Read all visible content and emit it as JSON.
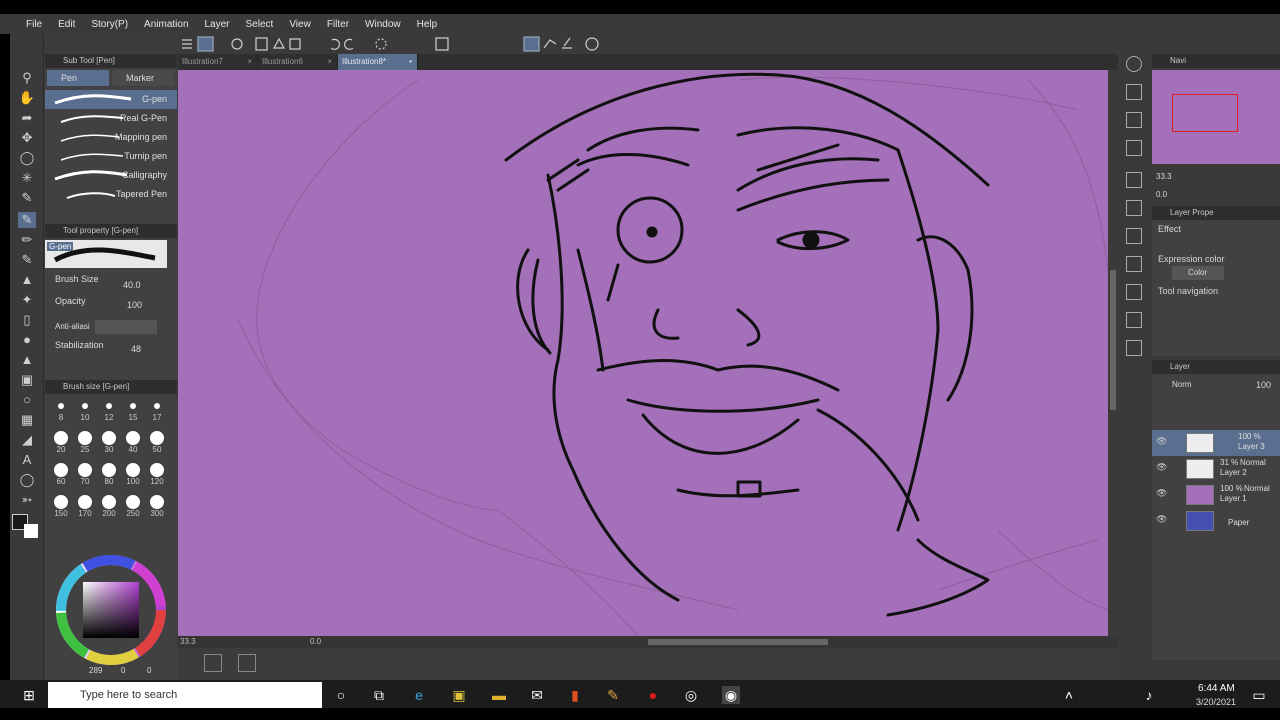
{
  "menu": [
    "File",
    "Edit",
    "Story(P)",
    "Animation",
    "Layer",
    "Select",
    "View",
    "Filter",
    "Window",
    "Help"
  ],
  "tabs": [
    {
      "label": "Illustration7"
    },
    {
      "label": "Illustration6"
    },
    {
      "label": "Illustration8*"
    }
  ],
  "subtool": {
    "title": "Sub Tool [Pen]",
    "tab_pen": "Pen",
    "tab_marker": "Marker",
    "brushes": [
      "G-pen",
      "Real G-Pen",
      "Mapping pen",
      "Turnip pen",
      "Calligraphy",
      "Tapered Pen"
    ]
  },
  "toolprop": {
    "title": "Tool property [G-pen]",
    "preview_label": "G-pen",
    "brush_size_label": "Brush Size",
    "brush_size": "40.0",
    "opacity_label": "Opacity",
    "opacity": "100",
    "antialias_label": "Anti-aliasi",
    "stabilization_label": "Stabilization",
    "stabilization": "48"
  },
  "brushsize": {
    "title": "Brush size [G-pen]",
    "sizes": [
      "8",
      "10",
      "12",
      "15",
      "17",
      "20",
      "25",
      "30",
      "40",
      "50",
      "60",
      "70",
      "80",
      "100",
      "120",
      "150",
      "170",
      "200",
      "250",
      "300"
    ]
  },
  "color": {
    "fg": "#ffffff",
    "bg": "#1a1a1a",
    "values": "289",
    "v1": "0",
    "v2": "0"
  },
  "canvas": {
    "bg": "#a470b9",
    "zoom": "33.3",
    "angle": "0.0"
  },
  "navigator": {
    "title": "Navi",
    "zoom": "33.3",
    "angle": "0.0"
  },
  "layerprops": {
    "title": "Layer Prope",
    "effect": "Effect",
    "expression_label": "Expression color",
    "expression_value": "Color",
    "toolnav": "Tool navigation"
  },
  "layerpanel": {
    "title": "Layer",
    "blend": "Norm",
    "opacity": "100",
    "layers": [
      {
        "pct": "100 %",
        "blend": "",
        "name": "Layer 3"
      },
      {
        "pct": "31 %",
        "blend": "Normal",
        "name": "Layer 2"
      },
      {
        "pct": "100 %",
        "blend": "Normal",
        "name": "Layer 1"
      },
      {
        "pct": "",
        "blend": "",
        "name": "Paper"
      }
    ]
  },
  "taskbar": {
    "search": "Type here to search",
    "time": "6:44 AM",
    "date": "3/20/2021"
  }
}
